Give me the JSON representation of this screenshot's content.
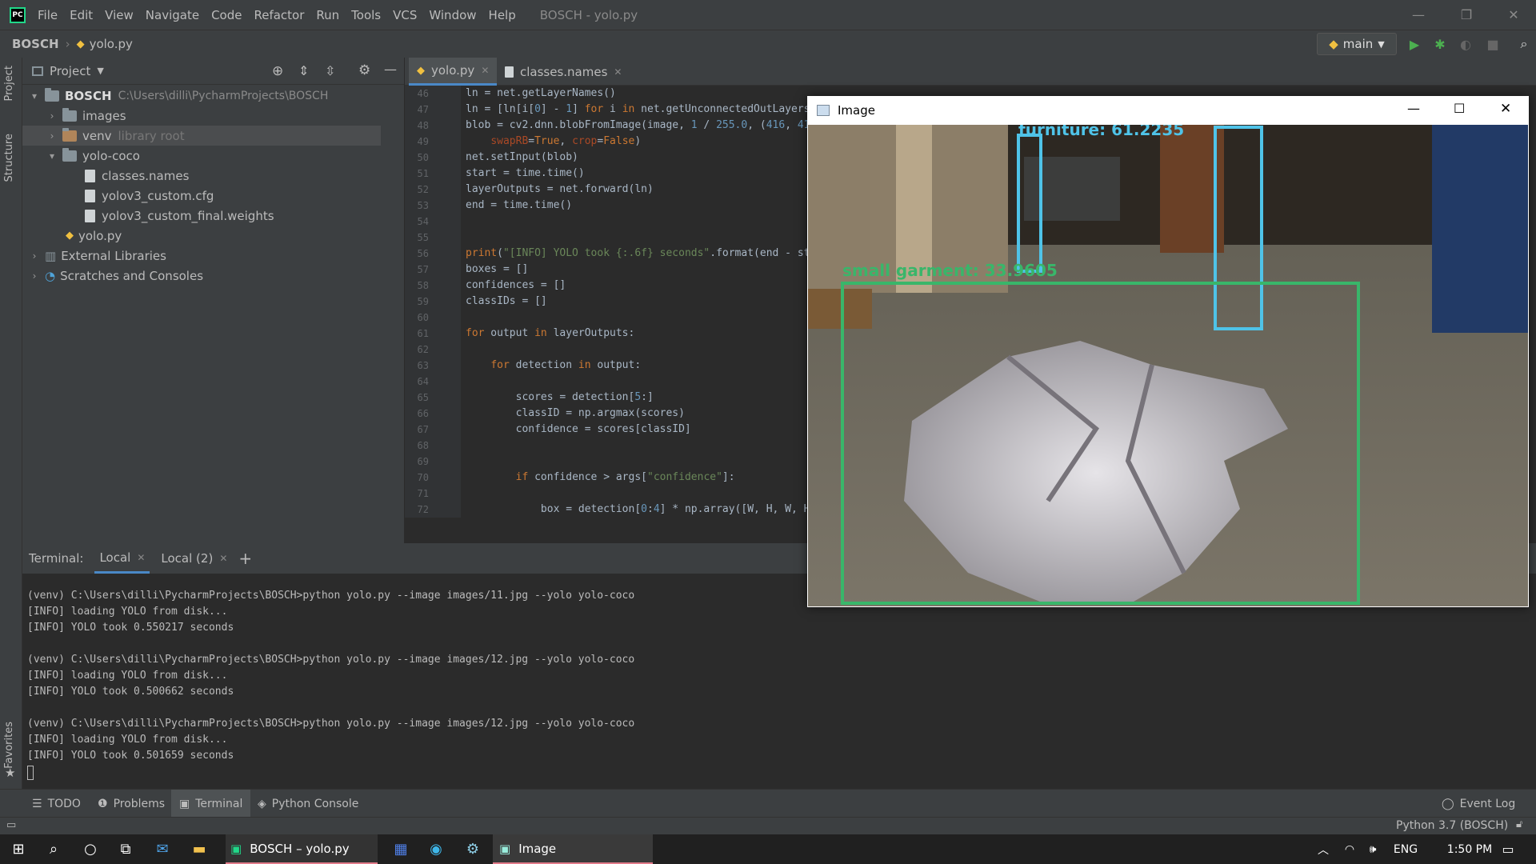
{
  "app": {
    "title": "BOSCH - yolo.py",
    "logo": "PC"
  },
  "menu": [
    "File",
    "Edit",
    "View",
    "Navigate",
    "Code",
    "Refactor",
    "Run",
    "Tools",
    "VCS",
    "Window",
    "Help"
  ],
  "navbar": {
    "project": "BOSCH",
    "file": "yolo.py",
    "branch": "main"
  },
  "project_panel": {
    "title": "Project",
    "root": {
      "name": "BOSCH",
      "path": "C:\\Users\\dilli\\PycharmProjects\\BOSCH"
    },
    "items": [
      {
        "label": "images"
      },
      {
        "label": "venv",
        "hint": "library root"
      },
      {
        "label": "yolo-coco"
      },
      {
        "label": "classes.names"
      },
      {
        "label": "yolov3_custom.cfg"
      },
      {
        "label": "yolov3_custom_final.weights"
      },
      {
        "label": "yolo.py"
      },
      {
        "label": "External Libraries"
      },
      {
        "label": "Scratches and Consoles"
      }
    ]
  },
  "side_labels": {
    "project": "Project",
    "structure": "Structure",
    "favorites": "Favorites"
  },
  "editor": {
    "tabs": [
      "yolo.py",
      "classes.names"
    ],
    "line_numbers": [
      "46",
      "47",
      "48",
      "49",
      "50",
      "51",
      "52",
      "53",
      "54",
      "55",
      "56",
      "57",
      "58",
      "59",
      "60",
      "61",
      "62",
      "63",
      "64",
      "65",
      "66",
      "67",
      "68",
      "69",
      "70",
      "71",
      "72"
    ]
  },
  "image_window": {
    "title": "Image",
    "detections": [
      {
        "label": "furniture: 61.2235",
        "color": "#4fc3e8"
      },
      {
        "label": "small garment: 33.9605",
        "color": "#39b66a"
      }
    ]
  },
  "terminal": {
    "label": "Terminal:",
    "tabs": [
      "Local",
      "Local (2)"
    ],
    "lines": [
      "(venv) C:\\Users\\dilli\\PycharmProjects\\BOSCH>python yolo.py --image images/11.jpg --yolo yolo-coco",
      "[INFO] loading YOLO from disk...",
      "[INFO] YOLO took 0.550217 seconds",
      "",
      "(venv) C:\\Users\\dilli\\PycharmProjects\\BOSCH>python yolo.py --image images/12.jpg --yolo yolo-coco",
      "[INFO] loading YOLO from disk...",
      "[INFO] YOLO took 0.500662 seconds",
      "",
      "(venv) C:\\Users\\dilli\\PycharmProjects\\BOSCH>python yolo.py --image images/12.jpg --yolo yolo-coco",
      "[INFO] loading YOLO from disk...",
      "[INFO] YOLO took 0.501659 seconds"
    ]
  },
  "bottom_tabs": [
    "TODO",
    "Problems",
    "Terminal",
    "Python Console"
  ],
  "event_log": "Event Log",
  "status": {
    "interpreter": "Python 3.7 (BOSCH)"
  },
  "taskbar": {
    "apps": [
      "BOSCH – yolo.py",
      "Image"
    ],
    "lang": "ENG",
    "time": "1:50 PM"
  }
}
